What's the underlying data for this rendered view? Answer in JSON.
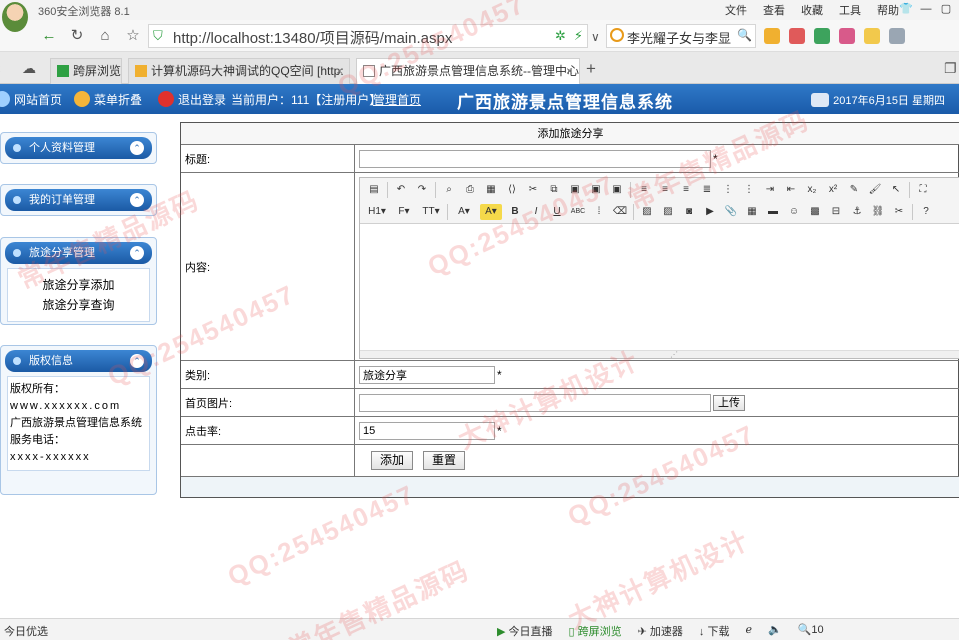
{
  "browser": {
    "app_title": "360安全浏览器 8.1",
    "menu": [
      "文件",
      "查看",
      "收藏",
      "工具",
      "帮助"
    ],
    "url_host": "http://localhost",
    "url_rest": ":13480/项目源码/main.aspx",
    "search_text": "李光耀子女与李显",
    "tabs": [
      {
        "label": "跨屏浏览"
      },
      {
        "label": "计算机源码大神调试的QQ空间 [http:"
      },
      {
        "label": "广西旅游景点管理信息系统--管理中心"
      }
    ]
  },
  "header": {
    "site_home": "网站首页",
    "menu_collapse": "菜单折叠",
    "logout": "退出登录",
    "current_user": "当前用户：111【注册用户】",
    "admin_home": "管理首页",
    "system_title": "广西旅游景点管理信息系统",
    "date": "2017年6月15日 星期四"
  },
  "sidebar": {
    "panels": [
      {
        "title": "个人资料管理"
      },
      {
        "title": "我的订单管理"
      },
      {
        "title": "旅途分享管理",
        "items": [
          "旅途分享添加",
          "旅途分享查询"
        ]
      },
      {
        "title": "版权信息"
      }
    ],
    "copyright": {
      "owner_label": "版权所有：",
      "website": "www.xxxxxx.com",
      "system_name": "广西旅游景点管理信息系统",
      "phone_label": "服务电话：",
      "phone": "xxxx-xxxxxx"
    }
  },
  "form": {
    "caption": "添加旅途分享",
    "title_label": "标题:",
    "title_value": "",
    "content_label": "内容:",
    "category_label": "类别:",
    "category_value": "旅途分享",
    "image_label": "首页图片:",
    "image_value": "",
    "upload_label": "上传",
    "clicks_label": "点击率:",
    "clicks_value": "15",
    "required_mark": "*",
    "add_label": "添加",
    "reset_label": "重置"
  },
  "statusbar": {
    "left": "今日优选",
    "items": [
      "今日直播",
      "跨屏浏览",
      "加速器",
      "下载"
    ],
    "zoom": "10"
  },
  "watermarks": [
    "QQ:254540457",
    "大神计算机设计",
    "常年售精品源码"
  ],
  "colors": {
    "header_blue": "#1a5ba9",
    "panel_border": "#a9c6e6",
    "watermark": "#e65050"
  }
}
